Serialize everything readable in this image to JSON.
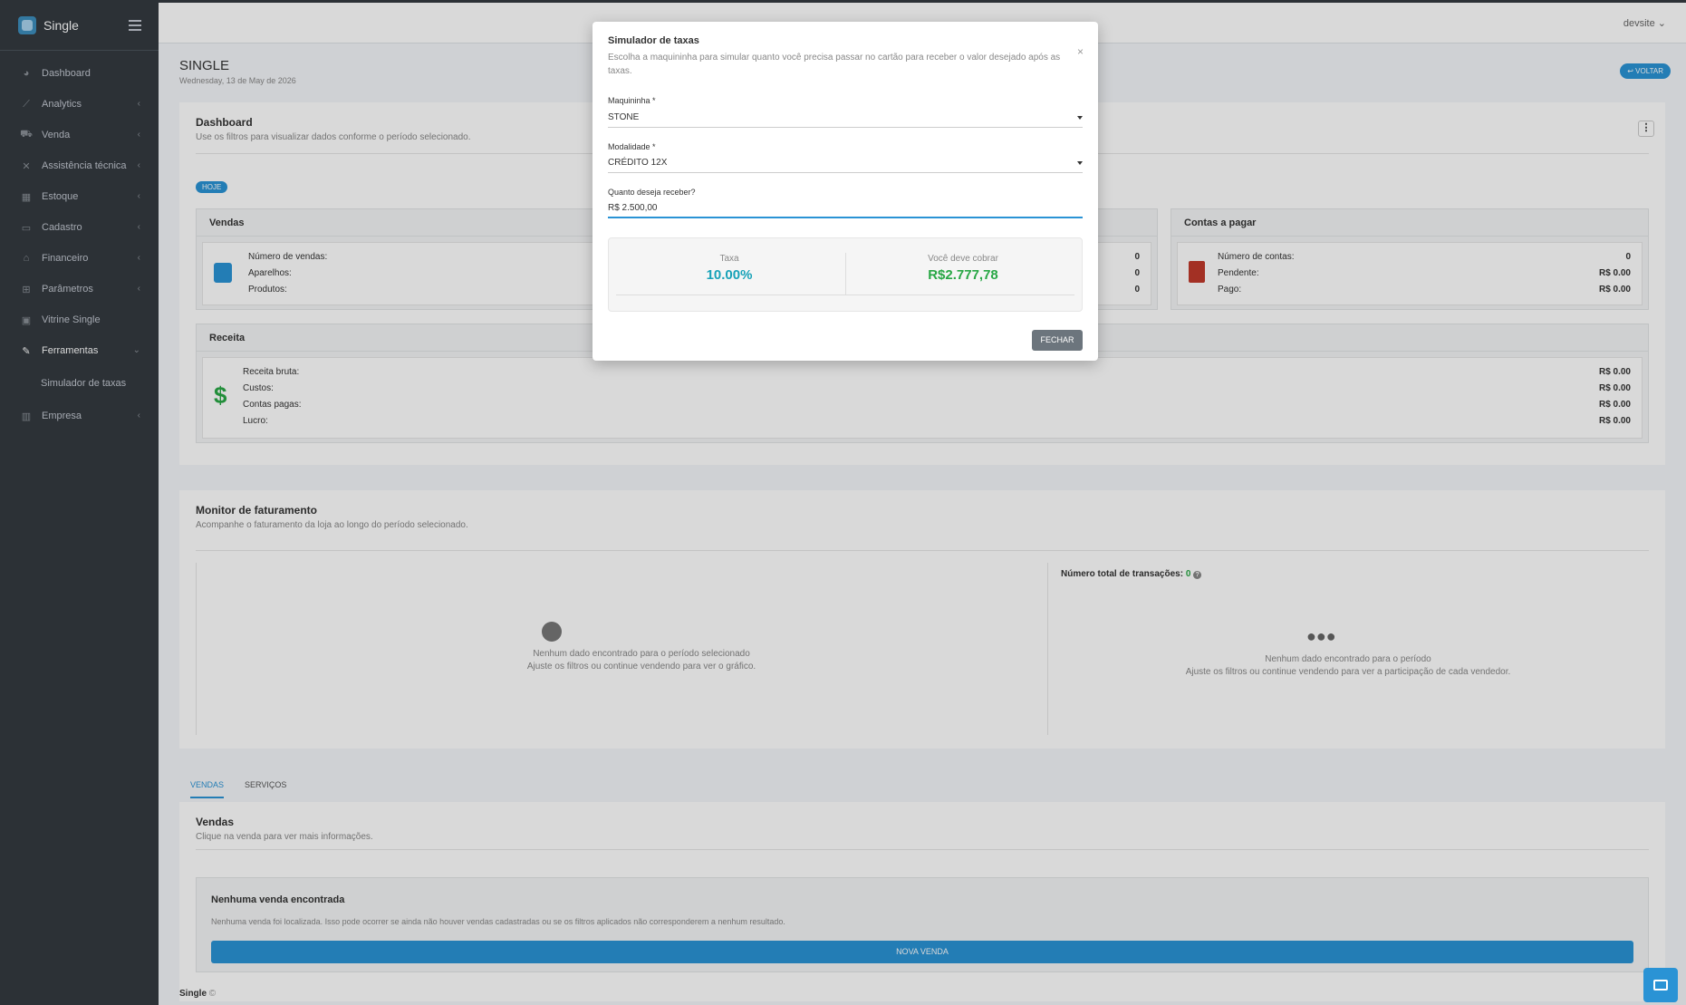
{
  "app": {
    "name": "Single",
    "user": "devsite"
  },
  "sidebar": {
    "items": [
      {
        "label": "Dashboard",
        "icon": "dashboard-icon"
      },
      {
        "label": "Analytics",
        "icon": "chart-line-icon"
      },
      {
        "label": "Venda",
        "icon": "cart-icon"
      },
      {
        "label": "Assistência técnica",
        "icon": "tools-icon"
      },
      {
        "label": "Estoque",
        "icon": "boxes-icon"
      },
      {
        "label": "Cadastro",
        "icon": "id-card-icon"
      },
      {
        "label": "Financeiro",
        "icon": "bank-icon"
      },
      {
        "label": "Parâmetros",
        "icon": "sitemap-icon"
      },
      {
        "label": "Vitrine Single",
        "icon": "store-icon"
      },
      {
        "label": "Ferramentas",
        "icon": "wrench-icon"
      },
      {
        "label": "Empresa",
        "icon": "building-icon"
      }
    ],
    "subitem": "Simulador de taxas"
  },
  "header": {
    "title": "SINGLE",
    "date": "Wednesday, 13 de May de 2026",
    "back": "VOLTAR"
  },
  "dashboard": {
    "title": "Dashboard",
    "subtitle": "Use os filtros para visualizar dados conforme o período selecionado.",
    "badge": "HOJE",
    "vendas": {
      "title": "Vendas",
      "rows": [
        {
          "label": "Número de vendas:",
          "value": "0"
        },
        {
          "label": "Aparelhos:",
          "value": "0"
        },
        {
          "label": "Produtos:",
          "value": "0"
        }
      ]
    },
    "contas": {
      "title": "Contas a pagar",
      "rows": [
        {
          "label": "Número de contas:",
          "value": "0"
        },
        {
          "label": "Pendente:",
          "value": "R$ 0.00"
        },
        {
          "label": "Pago:",
          "value": "R$ 0.00"
        }
      ]
    },
    "receita": {
      "title": "Receita",
      "rows": [
        {
          "label": "Receita bruta:",
          "value": "R$ 0.00"
        },
        {
          "label": "Custos:",
          "value": "R$ 0.00"
        },
        {
          "label": "Contas pagas:",
          "value": "R$ 0.00"
        },
        {
          "label": "Lucro:",
          "value": "R$ 0.00"
        }
      ]
    }
  },
  "monitor": {
    "title": "Monitor de faturamento",
    "subtitle": "Acompanhe o faturamento da loja ao longo do período selecionado.",
    "transactions_label": "Número total de transações:",
    "transactions_value": "0",
    "empty_left_1": "Nenhum dado encontrado para o período selecionado",
    "empty_left_2": "Ajuste os filtros ou continue vendendo para ver o gráfico.",
    "empty_right_1": "Nenhum dado encontrado para o período",
    "empty_right_2": "Ajuste os filtros ou continue vendendo para ver a participação de cada vendedor."
  },
  "tabs": [
    {
      "label": "VENDAS"
    },
    {
      "label": "SERVIÇOS"
    }
  ],
  "vendas_list": {
    "title": "Vendas",
    "subtitle": "Clique na venda para ver mais informações.",
    "empty_title": "Nenhuma venda encontrada",
    "empty_text": "Nenhuma venda foi localizada. Isso pode ocorrer se ainda não houver vendas cadastradas ou se os filtros aplicados não corresponderem a nenhum resultado.",
    "button": "NOVA VENDA"
  },
  "footer": {
    "brand": "Single",
    "mark": "©"
  },
  "modal": {
    "title": "Simulador de taxas",
    "description": "Escolha a maquininha para simular quanto você precisa passar no cartão para receber o valor desejado após as taxas.",
    "close": "×",
    "maquininha_label": "Maquininha *",
    "maquininha_value": "STONE",
    "modalidade_label": "Modalidade *",
    "modalidade_value": "CRÉDITO 12X",
    "valor_label": "Quanto deseja receber?",
    "valor_value": "R$ 2.500,00",
    "taxa_label": "Taxa",
    "taxa_value": "10.00%",
    "cobrar_label": "Você deve cobrar",
    "cobrar_value": "R$2.777,78",
    "fechar": "FECHAR"
  },
  "colors": {
    "primary": "#2a93d5",
    "taxa": "#17a2b8",
    "cobrar": "#28a745",
    "sidebar": "#343a40"
  }
}
